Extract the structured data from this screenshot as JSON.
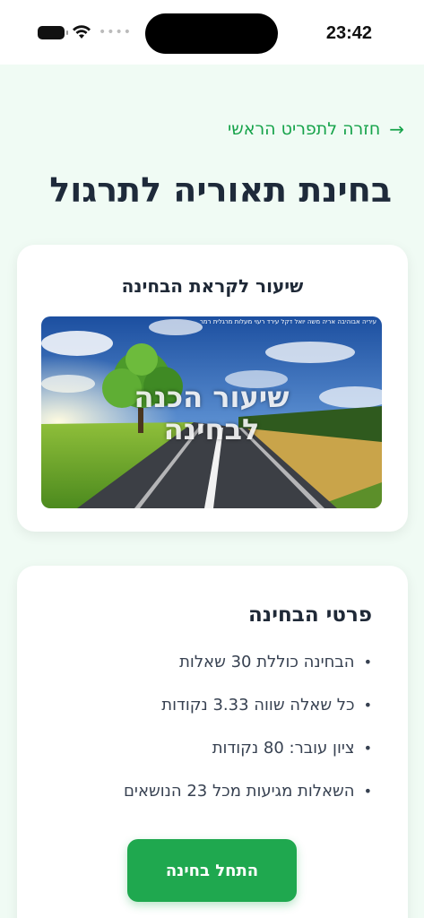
{
  "status_bar": {
    "time": "23:42",
    "signal_dots": "••••",
    "icons": [
      "battery-icon",
      "wifi-icon"
    ]
  },
  "nav": {
    "back_label": "חזרה לתפריט הראשי",
    "back_icon": "arrow-right-icon"
  },
  "page": {
    "title": "בחינת תאוריה לתרגול"
  },
  "lesson_card": {
    "title": "שיעור לקראת הבחינה",
    "image_caption_line1": "שיעור הכנה",
    "image_caption_line2": "לבחינה",
    "image_top_line": "עיריה אבוהיבה אריה משה יואל דקל עירד רעוי מעלות מרגלית רמר"
  },
  "details_card": {
    "title": "פרטי הבחינה",
    "items": [
      "הבחינה כוללת 30 שאלות",
      "כל שאלה שווה 3.33 נקודות",
      "ציון עובר: 80 נקודות",
      "השאלות מגיעות מכל 23 הנושאים"
    ],
    "bullet": "•",
    "start_button": "התחל בחינה"
  },
  "colors": {
    "accent": "#1fa84f",
    "link": "#16a34a",
    "background": "#f0fbf4",
    "title": "#1e2a3a"
  }
}
